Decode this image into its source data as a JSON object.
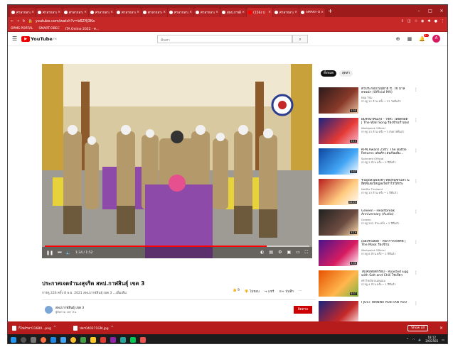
{
  "browser": {
    "tabs": [
      {
        "label": "ศาลากลางจังหวัด"
      },
      {
        "label": "ศาลากลางจังหวัด"
      },
      {
        "label": "ศาลากลางจังหวัด"
      },
      {
        "label": "ศาลากลางจังหวัด"
      },
      {
        "label": "ศาลากลางจังหวัด"
      },
      {
        "label": "ศาลากลางจังหวัด"
      },
      {
        "label": "ศาลากลางจังหวัด"
      },
      {
        "label": "ศาลากลางจังหวัด"
      },
      {
        "label": "สพป.กาฬสินธุ์"
      },
      {
        "label": "(156) ป"
      },
      {
        "label": "ศาลากลางจังหวัด"
      },
      {
        "label": "SMART-OBEC"
      }
    ],
    "new_tab": "+",
    "url": "youtube.com/watch?v=b6Z4J3Ka",
    "bookmarks": [
      "OPMS PORTAL",
      "SMART-OBEC",
      "ITA Online 2022 - ค..."
    ]
  },
  "youtube": {
    "logo_text": "YouTube",
    "logo_region": "TH",
    "search_placeholder": "ค้นหา",
    "notification_count": "9+",
    "avatar_letter": "A"
  },
  "video": {
    "title": "ประกาศเจตจำนงสุจริต สพป.กาฬสินธุ์ เขต 3",
    "meta": "การดู 226 ครั้ง  8 พ.ย. 2021  สพป.กาฬสินธุ์ เขต 3 ...เพิ่มเติม",
    "time": "1:34 / 1:52",
    "progress": 0.84,
    "like_count": "9",
    "dislike_label": "ไม่ชอบ",
    "share_label": "แชร์",
    "save_label": "บันทึก",
    "channel_name": "สพป.กาฬสินธุ์ เขต 3",
    "channel_subs": "ผู้ติดตาม 187 คน",
    "subscribe_label": "ติดตาม"
  },
  "sidebar": {
    "chips": [
      "ทั้งหมด",
      "สุดล่า"
    ],
    "recommendations": [
      {
        "title": "ตัวประกอบในนิยาย ft. ไข่ มาลีฮวนน่า (Official MV)",
        "channel": "ทอม ไข่ม",
        "views": "การดู 12 ล้าน ครั้ง • 13 วันที่แล้ว",
        "duration": "5:55",
        "colors": [
          "#2b1a1a",
          "#8a3a2a",
          "#e8c4a0"
        ]
      },
      {
        "title": "ผมรจนาคนเก่ง - วัชระ ไทยดีจอด | The Wall Song ร้องข้ามกำแพง",
        "channel": "Workpoint Official",
        "views": "การดู 13 ล้าน ครั้ง • 3 สัปดาห์ที่แล้ว",
        "duration": "3:13",
        "colors": [
          "#1a237e",
          "#e53935",
          "#f8bbd0"
        ]
      },
      {
        "title": "KPN Award 25th: The Battle Returns เล่นคัก เล่นกันเด้ม...",
        "channel": "Spinnerd Official",
        "views": "การดู 3 ล้าน ครั้ง • 3 ปีที่แล้ว",
        "duration": "2:57",
        "colors": [
          "#0d47a1",
          "#42a5f5",
          "#ffffff"
        ]
      },
      {
        "title": "รวมเพลงเพลงฮา ที่ฟังกันซ้ำแล้ว & ฮิตที่แต่งใหญ่ลงใจกำไรให้กระยอย...",
        "channel": "Netflix Thailand",
        "views": "การดู 13 ล้าน ครั้ง • 1 ปีที่แล้ว",
        "duration": "12:23",
        "colors": [
          "#b71c1c",
          "#ffcc80",
          "#ffffff"
        ]
      },
      {
        "title": "Greeen - Heartbreak Anniversary (Audio)",
        "channel": "Greeen",
        "views": "การดู 202 ล้าน ครั้ง • 2 ปีที่แล้ว",
        "duration": "3:19",
        "colors": [
          "#212121",
          "#6d4c41",
          "#ffe0b2"
        ]
      },
      {
        "title": "เพลงรักเลือด - หน้ากากเพชรดี | The Mask ร้องข้าม",
        "channel": "Workpoint Official",
        "views": "การดู 8 ล้าน ครั้ง • 2 ปีที่แล้ว",
        "duration": "3:06",
        "colors": [
          "#4a148c",
          "#d81b60",
          "#ffffff"
        ]
      },
      {
        "title": "ไข่เค็มทอดกรอบ - Roasted Egg with Salt and Chili ไข่เจียวแบบ...",
        "channel": "ครัวไข่เจียวแม่หม่อม",
        "views": "การดู 4 ล้าน ครั้ง • 1 ปีที่แล้ว",
        "duration": "8:57",
        "colors": [
          "#e65100",
          "#ffb74d",
          "#7cb342"
        ]
      },
      {
        "title": "I JUST WANNA PEN FAN YOU",
        "channel": "",
        "views": "",
        "duration": "",
        "colors": [
          "#1a237e",
          "#c62828",
          "#ffffff"
        ]
      }
    ]
  },
  "downloads": {
    "items": [
      "ก็ไฟล์ฯลฯ11680...png",
      "ปลา040271GN.jpg"
    ],
    "show_all": "Show all",
    "close": "×"
  },
  "taskbar": {
    "time": "18:12",
    "date": "2/6/2565"
  }
}
